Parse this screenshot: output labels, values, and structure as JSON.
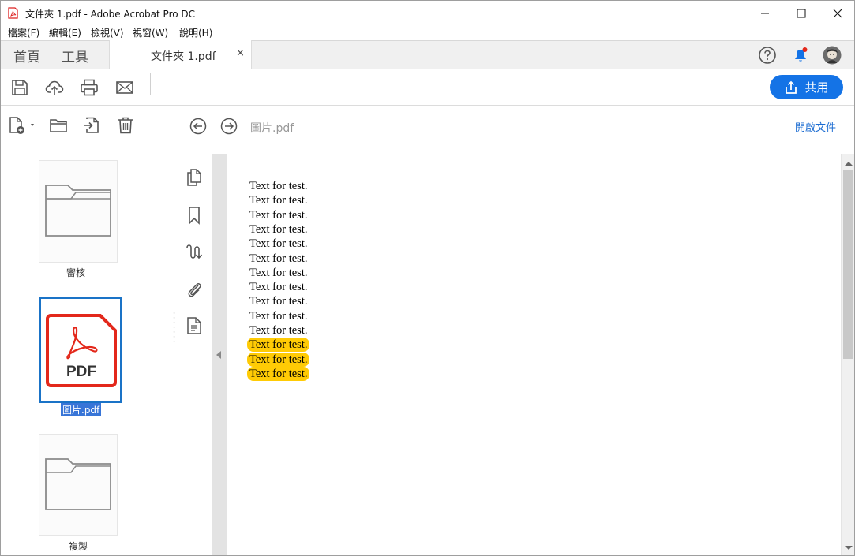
{
  "window": {
    "title": "文件夾 1.pdf - Adobe Acrobat Pro DC",
    "minimize_glyph": "—",
    "maximize_glyph": "☐",
    "close_glyph": "✕"
  },
  "menu": {
    "items": [
      "檔案(F)",
      "編輯(E)",
      "檢視(V)",
      "視窗(W)",
      "說明(H)"
    ]
  },
  "tabs": {
    "home": "首頁",
    "tools": "工具",
    "document": "文件夾 1.pdf",
    "close": "×"
  },
  "toolbar": {
    "share_label": "共用"
  },
  "files": {
    "items": [
      {
        "label": "審核",
        "type": "folder-icon"
      },
      {
        "label": "圖片.pdf",
        "type": "pdf-icon",
        "selected": true,
        "badge": "PDF"
      },
      {
        "label": "複製",
        "type": "folder-icon"
      }
    ]
  },
  "content": {
    "breadcrumb": "圖片.pdf",
    "open_document": "開啟文件"
  },
  "document": {
    "lines": [
      "Text for test.",
      "Text for test.",
      "Text for test.",
      "Text for test.",
      "Text for test.",
      "Text for test.",
      "Text for test.",
      "Text for test.",
      "Text for test.",
      "Text for test.",
      "Text for test.",
      "Text for test.",
      "Text for test.",
      "Text for test."
    ],
    "highlighted_from_index": 11
  },
  "colors": {
    "accent": "#1473e6",
    "highlight": "#ffcb05",
    "pdf_red": "#e3281b",
    "selection": "#3875d7"
  }
}
